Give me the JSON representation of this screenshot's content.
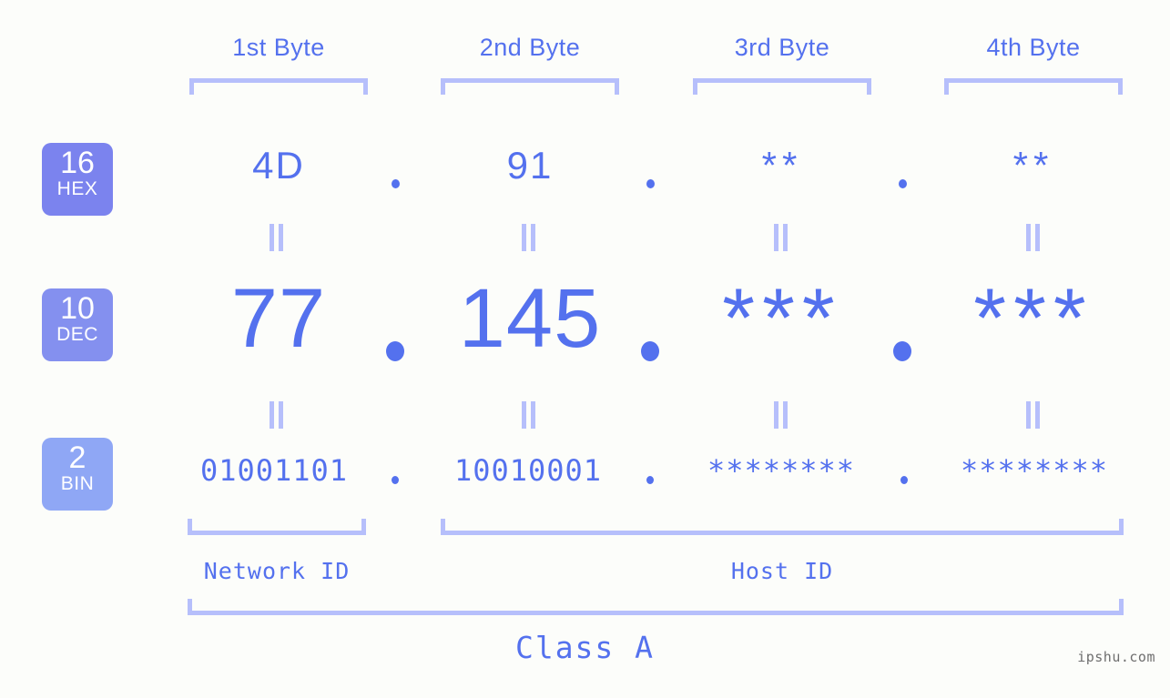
{
  "colors": {
    "background": "#fcfdfa",
    "accent": "#5471ee",
    "accent_light": "#b6bffb",
    "badge_hex": "#7b83ee",
    "badge_dec": "#8490ef",
    "badge_bin": "#8fa7f5",
    "watermark": "#6e6e6e"
  },
  "byte_headers": [
    {
      "label": "1st Byte"
    },
    {
      "label": "2nd Byte"
    },
    {
      "label": "3rd Byte"
    },
    {
      "label": "4th Byte"
    }
  ],
  "bases": [
    {
      "number": "16",
      "name": "HEX"
    },
    {
      "number": "10",
      "name": "DEC"
    },
    {
      "number": "2",
      "name": "BIN"
    }
  ],
  "rows": {
    "hex": {
      "base_number": "16",
      "base_name": "HEX",
      "values": [
        "4D",
        "91",
        "**",
        "**"
      ],
      "separator": "."
    },
    "dec": {
      "base_number": "10",
      "base_name": "DEC",
      "values": [
        "77",
        "145",
        "***",
        "***"
      ],
      "separator": "."
    },
    "bin": {
      "base_number": "2",
      "base_name": "BIN",
      "values": [
        "01001101",
        "10010001",
        "********",
        "********"
      ],
      "separator": "."
    }
  },
  "equals_marks": {
    "glyph": "||",
    "count_per_row": 4
  },
  "id_sections": [
    {
      "label": "Network ID"
    },
    {
      "label": "Host ID"
    }
  ],
  "class": {
    "label": "Class A"
  },
  "watermark": {
    "text": "ipshu.com"
  }
}
